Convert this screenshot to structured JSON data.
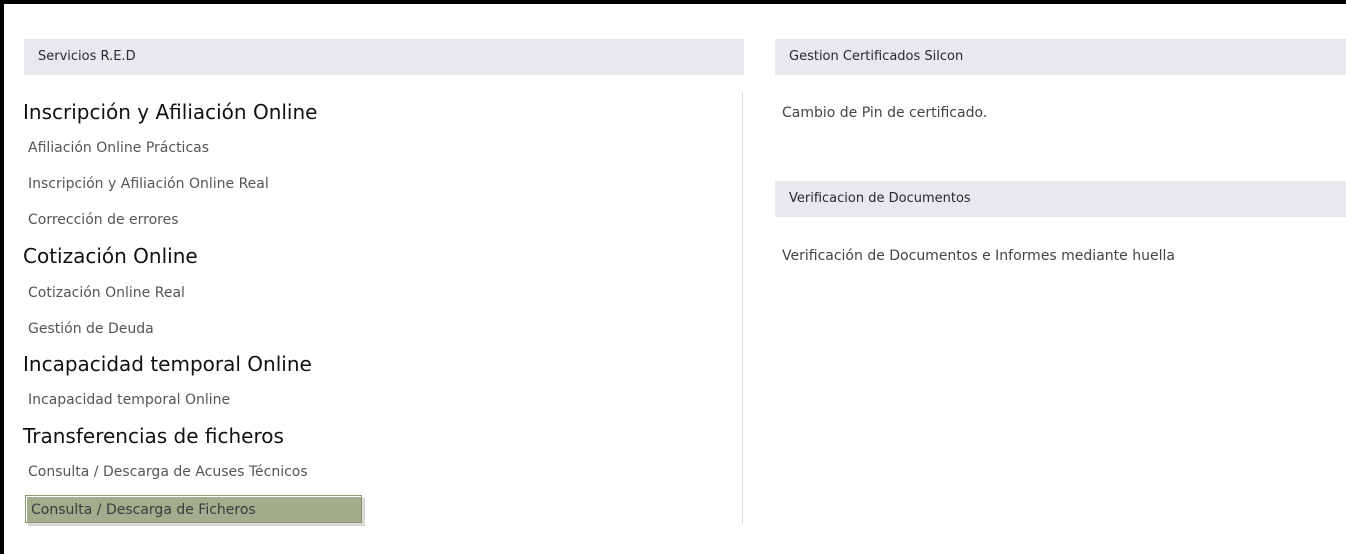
{
  "left_panel": {
    "header": "Servicios R.E.D",
    "sections": [
      {
        "title": "Inscripción y Afiliación Online",
        "items": [
          "Afiliación Online Prácticas",
          "Inscripción y Afiliación Online Real",
          "Corrección de errores"
        ]
      },
      {
        "title": "Cotización Online",
        "items": [
          "Cotización Online Real",
          "Gestión de Deuda"
        ]
      },
      {
        "title": "Incapacidad temporal Online",
        "items": [
          "Incapacidad temporal Online"
        ]
      },
      {
        "title": "Transferencias de ficheros",
        "items": [
          "Consulta / Descarga de Acuses Técnicos",
          "Consulta / Descarga de Ficheros"
        ]
      }
    ],
    "selected_item": "Consulta / Descarga de Ficheros"
  },
  "right_panel": {
    "certificates": {
      "header": "Gestion Certificados Silcon",
      "link": "Cambio de Pin de certificado."
    },
    "verification": {
      "header": "Verificacion de Documentos",
      "link": "Verificación de Documentos e Informes mediante huella"
    }
  },
  "colors": {
    "header_bg": "#e8e8ed",
    "selected_bg": "#a2ad8e",
    "link_text": "#555555",
    "frame_border": "#000000"
  }
}
